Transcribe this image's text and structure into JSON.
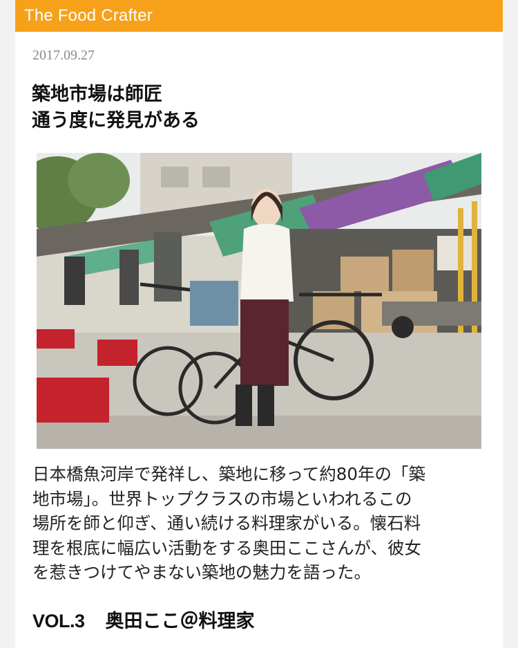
{
  "header": {
    "brand": "The Food Crafter",
    "brand_color": "#f7a11a"
  },
  "article": {
    "date": "2017.09.27",
    "title_lines": [
      "築地市場は師匠",
      "通う度に発見がある"
    ],
    "lead_lines": [
      "日本橋魚河岸で発祥し、築地に移って約80年の「築",
      "地市場」。世界トップクラスの市場といわれるこの",
      "場所を師と仰ぎ、通い続ける料理家がいる。懐石料",
      "理を根底に幅広い活動をする奥田ここさんが、彼女",
      "を惹きつけてやまない築地の魅力を語った。"
    ],
    "series_label": "VOL.3",
    "series_author": "奥田ここ＠料理家"
  },
  "photo": {
    "subject": "woman standing with bicycle at Tsukiji market street",
    "icon": "photo-icon"
  }
}
